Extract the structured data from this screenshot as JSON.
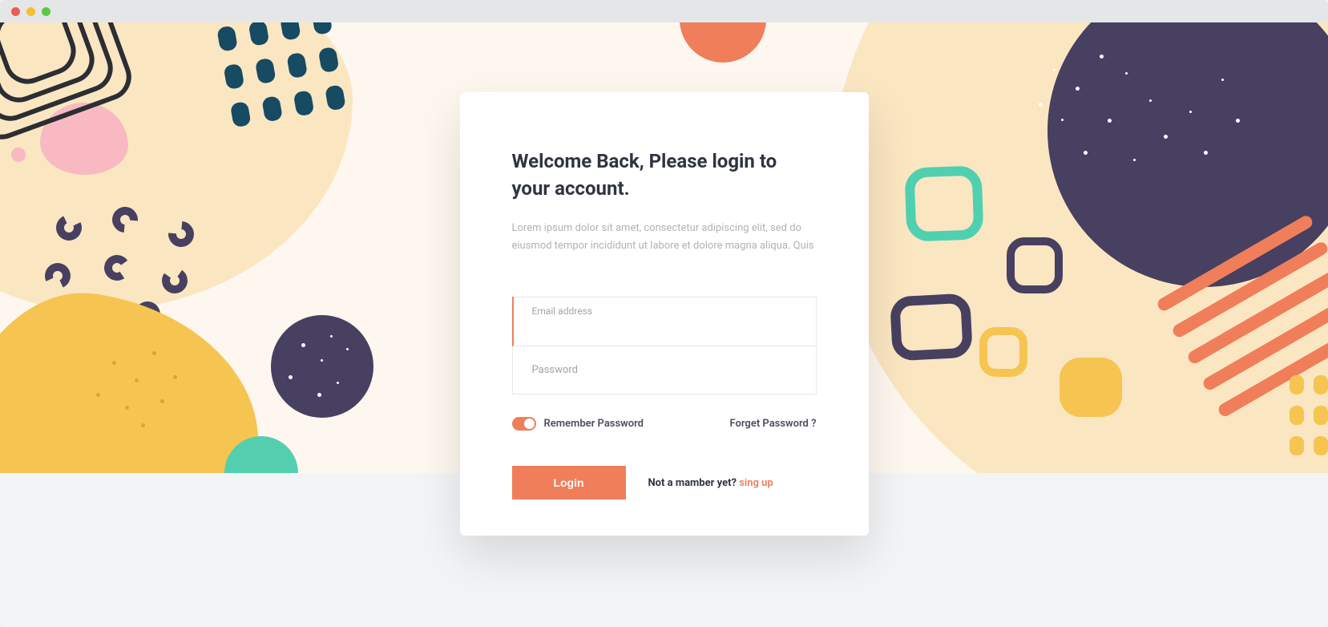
{
  "card": {
    "title": "Welcome Back, Please login to your account.",
    "subtitle": "Lorem ipsum dolor sit amet, consectetur adipiscing elit, sed do eiusmod tempor incididunt ut labore et dolore magna aliqua. Quis",
    "email_label": "Email address",
    "password_label": "Password",
    "remember_label": "Remember Password",
    "forget_label": "Forget Password ?",
    "login_label": "Login",
    "signup_prefix": "Not a mamber yet? ",
    "signup_link": "sing up"
  },
  "colors": {
    "accent": "#f07e5a",
    "navy": "#474060",
    "yellow": "#f6c451",
    "mint": "#4fd0b1",
    "pink": "#f8b9c3",
    "cream": "#fbe6c2",
    "text": "#2f3440",
    "muted": "#aeb2b8"
  }
}
